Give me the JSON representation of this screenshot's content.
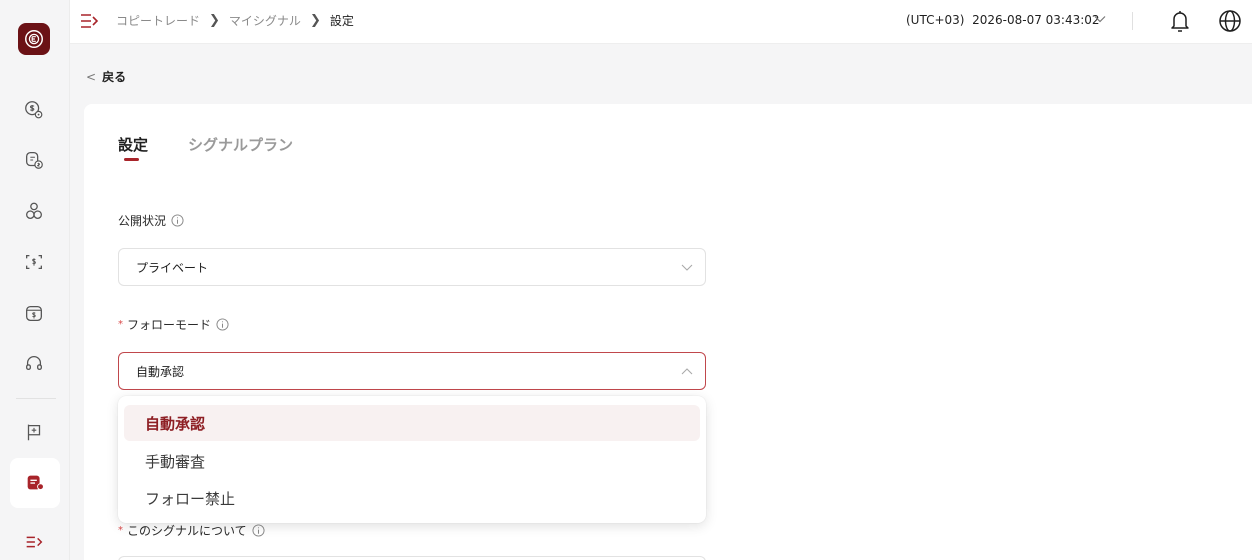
{
  "breadcrumb": {
    "items": [
      "コピートレード",
      "マイシグナル"
    ],
    "current": "設定"
  },
  "header": {
    "timezone": "(UTC+03)  2026-08-07 03:43:02"
  },
  "back": {
    "label": "戻る"
  },
  "tabs": [
    {
      "label": "設定",
      "active": true
    },
    {
      "label": "シグナルプラン",
      "active": false
    }
  ],
  "form": {
    "visibility": {
      "label": "公開状況",
      "value": "プライベート"
    },
    "follow_mode": {
      "required_mark": "*",
      "label": "フォローモード",
      "value": "自動承認"
    },
    "about": {
      "required_mark": "*",
      "label": "このシグナルについて"
    }
  },
  "dropdown": {
    "options": [
      {
        "label": "自動承認",
        "selected": true
      },
      {
        "label": "手動審査",
        "selected": false
      },
      {
        "label": "フォロー禁止",
        "selected": false
      }
    ]
  },
  "colors": {
    "accent": "#a8242a",
    "brand": "#6b1216"
  }
}
